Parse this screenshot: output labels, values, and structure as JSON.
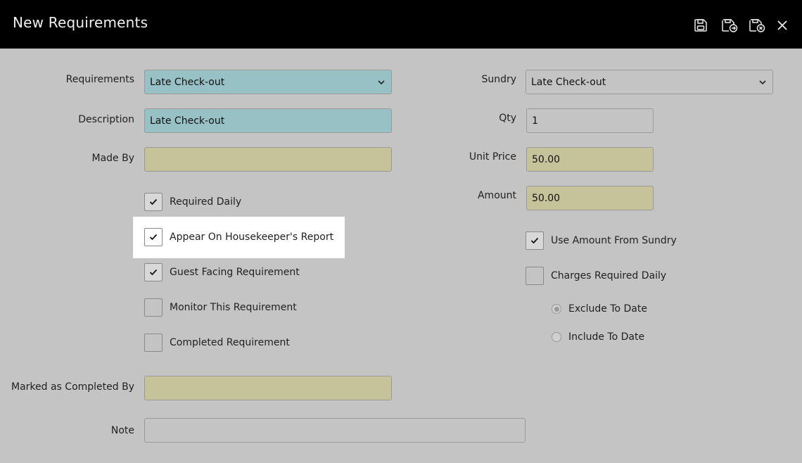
{
  "window": {
    "title": "New Requirements"
  },
  "toolbar": {
    "save_icon": "save-icon",
    "save_copy_icon": "save-copy-icon",
    "save_close_icon": "save-close-icon",
    "close_icon": "close-icon"
  },
  "left": {
    "requirements": {
      "label": "Requirements",
      "value": "Late Check-out"
    },
    "description": {
      "label": "Description",
      "value": "Late Check-out"
    },
    "made_by": {
      "label": "Made By",
      "value": ""
    },
    "checkboxes": [
      {
        "label": "Required Daily",
        "checked": true
      },
      {
        "label": "Appear On Housekeeper's Report",
        "checked": true
      },
      {
        "label": "Guest Facing Requirement",
        "checked": true
      },
      {
        "label": "Monitor This Requirement",
        "checked": false
      },
      {
        "label": "Completed Requirement",
        "checked": false
      }
    ],
    "marked_completed_by": {
      "label": "Marked as Completed By",
      "value": ""
    },
    "note": {
      "label": "Note",
      "value": ""
    }
  },
  "right": {
    "sundry": {
      "label": "Sundry",
      "value": "Late Check-out"
    },
    "qty": {
      "label": "Qty",
      "value": "1"
    },
    "unit_price": {
      "label": "Unit Price",
      "value": "50.00"
    },
    "amount": {
      "label": "Amount",
      "value": "50.00"
    },
    "use_amount": {
      "label": "Use Amount From Sundry",
      "checked": true
    },
    "charges_daily": {
      "label": "Charges Required Daily",
      "checked": false
    },
    "radios": [
      {
        "label": "Exclude To Date",
        "selected": true
      },
      {
        "label": "Include To Date",
        "selected": false
      }
    ]
  },
  "colors": {
    "titlebar": "#000000",
    "teal_field": "#97c1c4",
    "khaki_field": "#c6c39a",
    "background": "#c4c4c4",
    "highlight": "#ffffff"
  }
}
